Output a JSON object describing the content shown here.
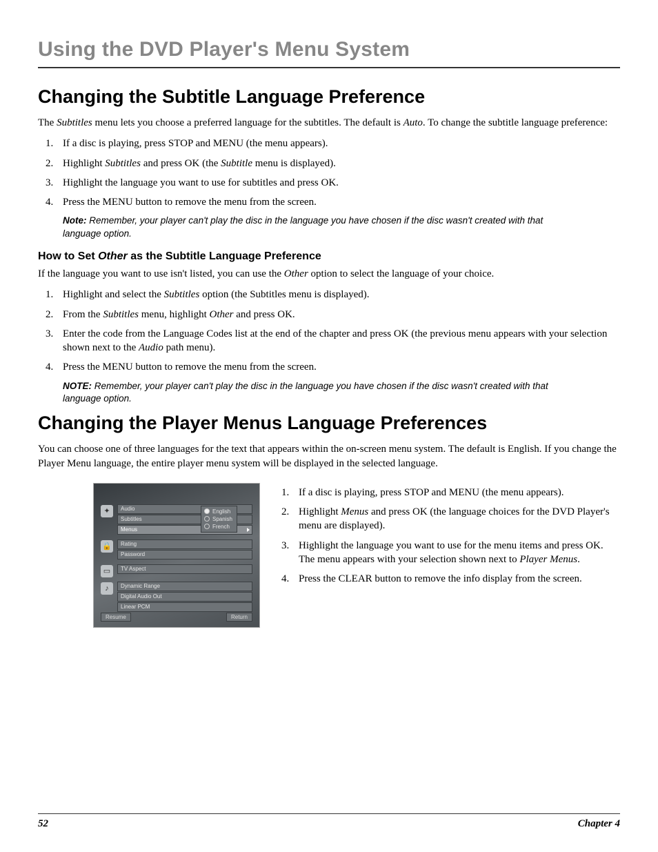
{
  "header": "Using the DVD Player's Menu System",
  "sec1": {
    "title": "Changing the Subtitle Language Preference",
    "intro_pre": "The ",
    "intro_em1": "Subtitles",
    "intro_mid": " menu lets you choose a preferred language for the subtitles. The default is ",
    "intro_em2": "Auto",
    "intro_post": ". To change the subtitle language preference:",
    "steps": {
      "s1": "If a disc is playing, press STOP and MENU (the menu appears).",
      "s2_pre": "Highlight ",
      "s2_em1": "Subtitles",
      "s2_mid": " and press OK (the ",
      "s2_em2": "Subtitle",
      "s2_post": " menu is displayed).",
      "s3": "Highlight the language you want to use for subtitles and press OK.",
      "s4": "Press the MENU button to remove the menu from the screen."
    },
    "note_label": "Note:",
    "note": " Remember, your player can't play the disc in the language you have chosen if the disc wasn't created with that language option."
  },
  "sec1b": {
    "title_pre": "How to Set ",
    "title_em": "Other",
    "title_post": " as the Subtitle Language Preference",
    "intro_pre": "If the language you want to use isn't listed, you can use the ",
    "intro_em": "Other",
    "intro_post": " option to select the language of your choice.",
    "steps": {
      "s1_pre": "Highlight and select the ",
      "s1_em": "Subtitles",
      "s1_post": " option (the Subtitles menu is displayed).",
      "s2_pre": "From the ",
      "s2_em1": "Subtitles",
      "s2_mid": " menu, highlight ",
      "s2_em2": "Other",
      "s2_post": " and press OK.",
      "s3_pre": "Enter the code from the Language Codes list at the end of the chapter and press OK (the previous menu appears with your selection shown next to the ",
      "s3_em": "Audio",
      "s3_post": " path menu).",
      "s4": "Press the MENU button to remove the menu from the screen."
    },
    "note_label": "NOTE:",
    "note": " Remember, your player can't play the disc in the language you have chosen if the disc wasn't created with that language option."
  },
  "sec2": {
    "title": "Changing the Player Menus Language Preferences",
    "intro": "You can choose one of three languages for the text that appears within the on-screen menu system. The default is English. If you change the Player Menu language, the entire player menu system will be displayed in the selected language.",
    "steps": {
      "s1": "If a disc is playing, press STOP and MENU (the menu appears).",
      "s2_pre": "Highlight ",
      "s2_em": "Menus",
      "s2_post": " and press OK (the language choices for the DVD Player's menu are displayed).",
      "s3_pre": "Highlight the language you want to use for the menu items and press OK. The menu appears with your selection shown next to ",
      "s3_em": "Player Menus",
      "s3_post": ".",
      "s4": "Press the CLEAR button to remove the info display from the screen."
    }
  },
  "figure": {
    "group1": {
      "a": "Audio",
      "b": "Subtitles",
      "c": "Menus"
    },
    "group2": {
      "a": "Rating",
      "b": "Password"
    },
    "group3": {
      "a": "TV Aspect"
    },
    "group4": {
      "a": "Dynamic Range",
      "b": "Digital Audio Out",
      "c": "Linear PCM"
    },
    "langs": {
      "a": "English",
      "b": "Spanish",
      "c": "French"
    },
    "resume": "Resume",
    "ret": "Return"
  },
  "footer": {
    "page": "52",
    "chapter": "Chapter 4"
  }
}
